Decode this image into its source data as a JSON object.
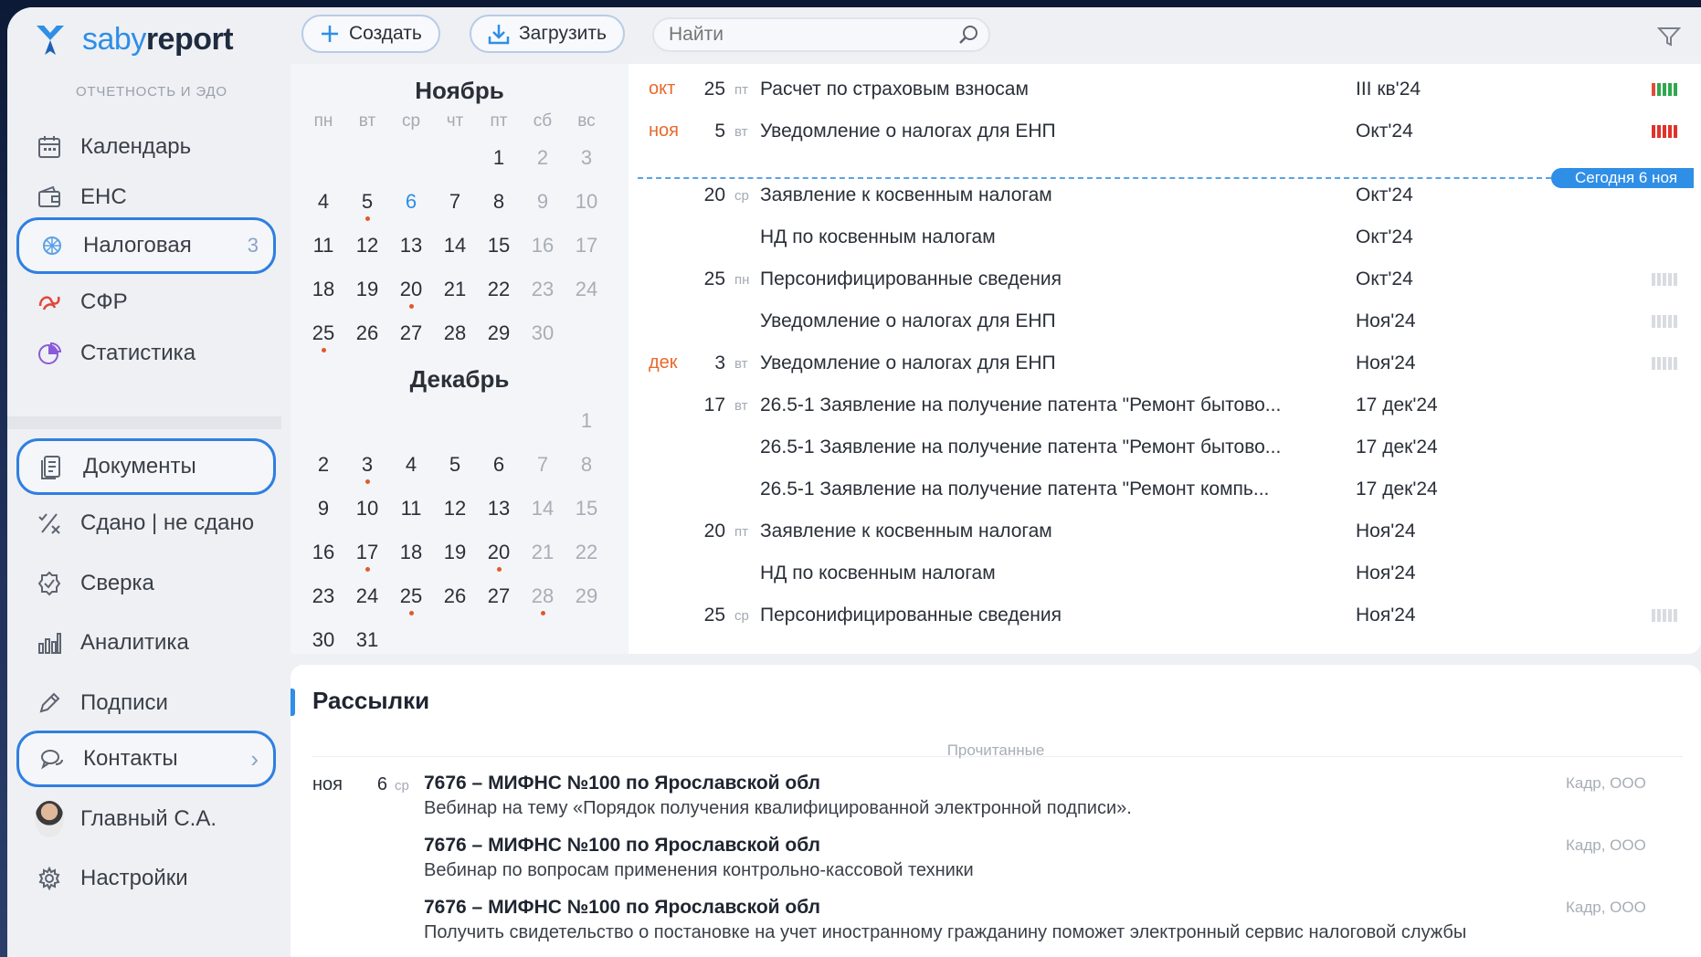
{
  "app": {
    "brand_a": "saby",
    "brand_b": "report",
    "subtitle": "ОТЧЕТНОСТЬ И ЭДО"
  },
  "nav": {
    "calendar": "Календарь",
    "ens": "ЕНС",
    "tax": "Налоговая",
    "tax_count": "3",
    "sfr": "СФР",
    "stats": "Статистика",
    "docs": "Документы",
    "submitted": "Сдано | не сдано",
    "reconcile": "Сверка",
    "analytics": "Аналитика",
    "signatures": "Подписи",
    "contacts": "Контакты",
    "user": "Главный С.А.",
    "settings": "Настройки"
  },
  "toolbar": {
    "create": "Создать",
    "upload": "Загрузить",
    "search_placeholder": "Найти"
  },
  "calendar": {
    "dow": [
      "пн",
      "вт",
      "ср",
      "чт",
      "пт",
      "сб",
      "вс"
    ],
    "months": [
      {
        "title": "Ноябрь",
        "weeks": [
          [
            "",
            "",
            "",
            "",
            "1",
            "2",
            "3"
          ],
          [
            "4",
            "5",
            "6",
            "7",
            "8",
            "9",
            "10"
          ],
          [
            "11",
            "12",
            "13",
            "14",
            "15",
            "16",
            "17"
          ],
          [
            "18",
            "19",
            "20",
            "21",
            "22",
            "23",
            "24"
          ],
          [
            "25",
            "26",
            "27",
            "28",
            "29",
            "30",
            ""
          ]
        ],
        "dots": [
          "5",
          "20",
          "25"
        ],
        "today": "6"
      },
      {
        "title": "Декабрь",
        "weeks": [
          [
            "",
            "",
            "",
            "",
            "",
            "",
            "1"
          ],
          [
            "2",
            "3",
            "4",
            "5",
            "6",
            "7",
            "8"
          ],
          [
            "9",
            "10",
            "11",
            "12",
            "13",
            "14",
            "15"
          ],
          [
            "16",
            "17",
            "18",
            "19",
            "20",
            "21",
            "22"
          ],
          [
            "23",
            "24",
            "25",
            "26",
            "27",
            "28",
            "29"
          ],
          [
            "30",
            "31",
            "",
            "",
            "",
            "",
            ""
          ]
        ],
        "dots": [
          "3",
          "17",
          "20",
          "25",
          "28"
        ],
        "today": ""
      }
    ]
  },
  "events": {
    "today_badge": "Сегодня 6 ноя",
    "rows": [
      {
        "mon": "окт",
        "day": "25",
        "dow": "пт",
        "title": "Расчет по страховым взносам",
        "period": "III кв'24",
        "bars": "green"
      },
      {
        "mon": "ноя",
        "day": "5",
        "dow": "вт",
        "title": "Уведомление о налогах для ЕНП",
        "period": "Окт'24",
        "bars": "red"
      },
      {
        "mon": "",
        "day": "20",
        "dow": "ср",
        "title": "Заявление к косвенным налогам",
        "period": "Окт'24",
        "bars": ""
      },
      {
        "mon": "",
        "day": "",
        "dow": "",
        "title": "НД по косвенным налогам",
        "period": "Окт'24",
        "bars": ""
      },
      {
        "mon": "",
        "day": "25",
        "dow": "пн",
        "title": "Персонифицированные сведения",
        "period": "Окт'24",
        "bars": "grey"
      },
      {
        "mon": "",
        "day": "",
        "dow": "",
        "title": "Уведомление о налогах для ЕНП",
        "period": "Ноя'24",
        "bars": "grey"
      },
      {
        "mon": "дек",
        "day": "3",
        "dow": "вт",
        "title": "Уведомление о налогах для ЕНП",
        "period": "Ноя'24",
        "bars": "grey"
      },
      {
        "mon": "",
        "day": "17",
        "dow": "вт",
        "title": "26.5-1 Заявление на получение патента \"Ремонт бытово...",
        "period": "17 дек'24",
        "bars": ""
      },
      {
        "mon": "",
        "day": "",
        "dow": "",
        "title": "26.5-1 Заявление на получение патента \"Ремонт бытово...",
        "period": "17 дек'24",
        "bars": ""
      },
      {
        "mon": "",
        "day": "",
        "dow": "",
        "title": "26.5-1 Заявление на получение патента \"Ремонт компь...",
        "period": "17 дек'24",
        "bars": ""
      },
      {
        "mon": "",
        "day": "20",
        "dow": "пт",
        "title": "Заявление к косвенным налогам",
        "period": "Ноя'24",
        "bars": ""
      },
      {
        "mon": "",
        "day": "",
        "dow": "",
        "title": "НД по косвенным налогам",
        "period": "Ноя'24",
        "bars": ""
      },
      {
        "mon": "",
        "day": "25",
        "dow": "ср",
        "title": "Персонифицированные сведения",
        "period": "Ноя'24",
        "bars": "grey"
      }
    ]
  },
  "mailings": {
    "title": "Рассылки",
    "read_label": "Прочитанные",
    "items": [
      {
        "mon": "ноя",
        "day": "6",
        "dow": "ср",
        "from": "7676 – МИФНС №100 по Ярославской обл",
        "text": "Вебинар на тему «Порядок получения квалифицированной электронной подписи».",
        "org": "Кадр, ООО"
      },
      {
        "mon": "",
        "day": "",
        "dow": "",
        "from": "7676 – МИФНС №100 по Ярославской обл",
        "text": "Вебинар по вопросам применения контрольно-кассовой техники",
        "org": "Кадр, ООО"
      },
      {
        "mon": "",
        "day": "",
        "dow": "",
        "from": "7676 – МИФНС №100 по Ярославской обл",
        "text": "Получить свидетельство о постановке на учет иностранному гражданину поможет электронный сервис налоговой службы",
        "org": "Кадр, ООО"
      }
    ]
  },
  "colors": {
    "accent": "#2f8ee6",
    "month_accent": "#e8692c",
    "dot": "#e05a2a"
  }
}
